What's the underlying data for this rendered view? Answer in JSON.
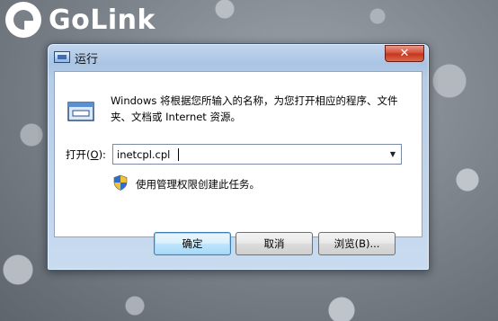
{
  "logo": {
    "text": "GoLink"
  },
  "window": {
    "title": "运行",
    "close_label": "✕",
    "description": "Windows 将根据您所输入的名称，为您打开相应的程序、文件夹、文档或 Internet 资源。",
    "open_label_prefix": "打开(",
    "open_label_hotkey": "O",
    "open_label_suffix": "):",
    "command_value": "inetcpl.cpl",
    "admin_note": "使用管理权限创建此任务。",
    "buttons": {
      "ok": "确定",
      "cancel": "取消",
      "browse": "浏览(B)..."
    }
  },
  "colors": {
    "titlebar": "#b7cde7",
    "close": "#c53218",
    "default_button": "#a7d9f5"
  }
}
